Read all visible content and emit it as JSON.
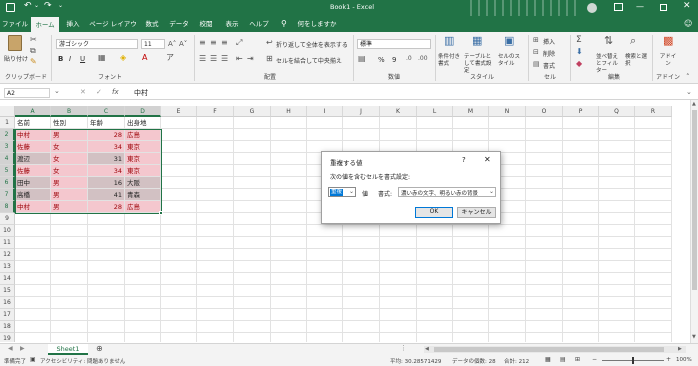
{
  "titlebar": {
    "autosave_label": "",
    "window_title": "Book1 - Excel",
    "search_hint": "",
    "colors": {
      "brand": "#217346"
    }
  },
  "tabs": [
    "ファイル",
    "ホーム",
    "挿入",
    "ページ レイアウト",
    "数式",
    "データ",
    "校閲",
    "表示",
    "ヘルプ",
    "何をしますか"
  ],
  "ribbon": {
    "clipboard": {
      "paste_label": "貼り付け",
      "group_label": "クリップボード"
    },
    "font": {
      "font_name": "游ゴシック",
      "font_size": "11",
      "bold": "B",
      "italic": "I",
      "underline": "U",
      "group_label": "フォント"
    },
    "alignment": {
      "wrap_label": "折り返して全体を表示する",
      "merge_label": "セルを結合して中央揃え",
      "group_label": "配置"
    },
    "number": {
      "format_value": "標準",
      "percent": "%",
      "comma": "9",
      "group_label": "数値"
    },
    "styles": {
      "cond_format_label": "条件付き書式",
      "table_format_label": "テーブルとして書式設定",
      "cell_style_label": "セルのスタイル",
      "group_label": "スタイル"
    },
    "cells": {
      "insert_label": "挿入",
      "delete_label": "削除",
      "format_label": "書式",
      "group_label": "セル"
    },
    "editing": {
      "sort_label": "並べ替えとフィルター",
      "find_label": "検索と選択",
      "group_label": "編集"
    },
    "addins": {
      "addin_label": "アドイン",
      "group_label": "アドイン"
    }
  },
  "formula_bar": {
    "name_box": "A2",
    "fx": "fx",
    "value": "中村"
  },
  "grid": {
    "columns": [
      "A",
      "B",
      "C",
      "D",
      "E",
      "F",
      "G",
      "H",
      "I",
      "J",
      "K",
      "L",
      "M",
      "N",
      "O",
      "P",
      "Q",
      "R"
    ],
    "selected_columns": [
      "A",
      "B",
      "C",
      "D"
    ],
    "rows": [
      "1",
      "2",
      "3",
      "4",
      "5",
      "6",
      "7",
      "8",
      "9",
      "10",
      "11",
      "12",
      "13",
      "14",
      "15",
      "16",
      "17",
      "18",
      "19"
    ],
    "selected_rows": [
      "2",
      "3",
      "4",
      "5",
      "6",
      "7",
      "8"
    ],
    "data": [
      {
        "name": "名前",
        "gender": "性別",
        "age": "年齢",
        "place": "出身地",
        "dup": [
          false,
          false,
          false,
          false
        ]
      },
      {
        "name": "中村",
        "gender": "男",
        "age": "28",
        "place": "広島",
        "dup": [
          true,
          true,
          true,
          true
        ]
      },
      {
        "name": "佐藤",
        "gender": "女",
        "age": "34",
        "place": "東京",
        "dup": [
          true,
          true,
          true,
          true
        ]
      },
      {
        "name": "渡辺",
        "gender": "女",
        "age": "31",
        "place": "東京",
        "dup": [
          false,
          true,
          false,
          true
        ]
      },
      {
        "name": "佐藤",
        "gender": "女",
        "age": "34",
        "place": "東京",
        "dup": [
          true,
          true,
          true,
          true
        ]
      },
      {
        "name": "田中",
        "gender": "男",
        "age": "16",
        "place": "大阪",
        "dup": [
          false,
          true,
          false,
          false
        ]
      },
      {
        "name": "高橋",
        "gender": "男",
        "age": "41",
        "place": "青森",
        "dup": [
          false,
          true,
          false,
          false
        ]
      },
      {
        "name": "中村",
        "gender": "男",
        "age": "28",
        "place": "広島",
        "dup": [
          true,
          true,
          true,
          true
        ]
      }
    ],
    "colors": {
      "dup_fill": "#f4c7ce",
      "dup_text": "#9c0006"
    }
  },
  "dialog": {
    "title": "重複する値",
    "help": "?",
    "close": "✕",
    "prompt": "次の値を含むセルを書式設定:",
    "type_value": "重複",
    "value_suffix": "値",
    "format_label": "書式:",
    "format_value": "濃い赤の文字、明るい赤の背景",
    "ok_label": "OK",
    "cancel_label": "キャンセル"
  },
  "sheetbar": {
    "sheet_name": "Sheet1"
  },
  "status": {
    "ready": "準備完了",
    "accessibility": "アクセシビリティ: 問題ありません",
    "average": "平均: 30.28571429",
    "count": "データの個数: 28",
    "sum": "合計: 212",
    "zoom": "100%"
  }
}
